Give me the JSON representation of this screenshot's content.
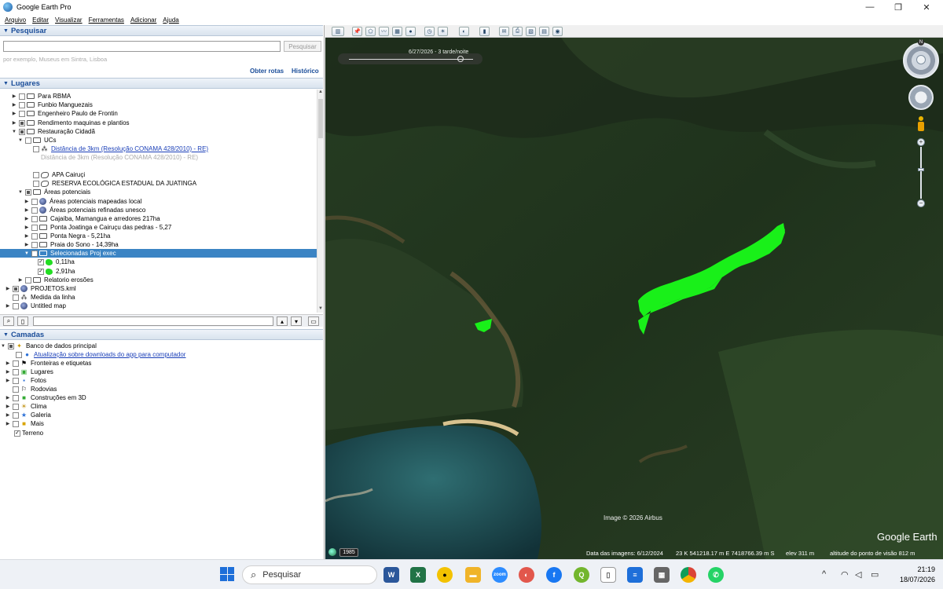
{
  "window": {
    "title": "Google Earth Pro",
    "minimize": "—",
    "maximize": "❐",
    "close": "✕"
  },
  "menu": [
    "Arquivo",
    "Editar",
    "Visualizar",
    "Ferramentas",
    "Adicionar",
    "Ajuda"
  ],
  "search": {
    "header": "Pesquisar",
    "input_value": "",
    "button": "Pesquisar",
    "hint": "por exemplo, Museus em Sintra, Lisboa",
    "get_directions": "Obter rotas",
    "history": "Histórico"
  },
  "places": {
    "header": "Lugares",
    "items": [
      {
        "label": "Para RBMA",
        "kind": "folder"
      },
      {
        "label": "Funbio Manguezais",
        "kind": "folder"
      },
      {
        "label": "Engenheiro Paulo de Frontin",
        "kind": "folder"
      },
      {
        "label": "Rendimento maquinas e plantios",
        "kind": "folder"
      },
      {
        "label": "Restauração Cidadã",
        "kind": "folder"
      },
      {
        "label": "UCs",
        "kind": "folder"
      },
      {
        "label": "Distância de 3km (Resolução CONAMA 428/2010) - RE)",
        "kind": "link"
      },
      {
        "label": "Distância de 3km (Resolução CONAMA 428/2010) - RE)",
        "kind": "grey"
      },
      {
        "label": "APA Cairuçi",
        "kind": "polygon"
      },
      {
        "label": "RESERVA ECOLÓGICA ESTADUAL DA JUATINGA",
        "kind": "polygon"
      },
      {
        "label": "Áreas potenciais",
        "kind": "folder"
      },
      {
        "label": "Áreas potenciais mapeadas local",
        "kind": "kml"
      },
      {
        "label": "Áreas potenciais refinadas unesco",
        "kind": "kml"
      },
      {
        "label": "Cajaíba, Mamangua e arredores 217ha",
        "kind": "folder"
      },
      {
        "label": "Ponta Joatinga e Cairuçu das pedras - 5,27",
        "kind": "folder"
      },
      {
        "label": "Ponta Negra - 5,21ha",
        "kind": "folder"
      },
      {
        "label": "Praia do Sono - 14,39ha",
        "kind": "folder"
      },
      {
        "label": "Selecionadas Proj exec",
        "kind": "folder"
      },
      {
        "label": "0,11ha",
        "kind": "poly"
      },
      {
        "label": "2,91ha",
        "kind": "poly"
      },
      {
        "label": "Relatorio erosões",
        "kind": "folder"
      },
      {
        "label": "PROJETOS.kml",
        "kind": "kml"
      },
      {
        "label": "Medida da linha",
        "kind": "path"
      },
      {
        "label": "Untitled map",
        "kind": "kml"
      }
    ]
  },
  "layers": {
    "header": "Camadas",
    "items": [
      {
        "label": "Banco de dados principal"
      },
      {
        "label": "Atualização sobre downloads do app para computador"
      },
      {
        "label": "Fronteiras e etiquetas"
      },
      {
        "label": "Lugares"
      },
      {
        "label": "Fotos"
      },
      {
        "label": "Rodovias"
      },
      {
        "label": "Construções em 3D"
      },
      {
        "label": "Clima"
      },
      {
        "label": "Galeria"
      },
      {
        "label": "Mais"
      },
      {
        "label": "Terreno"
      }
    ]
  },
  "map": {
    "time_label": "6/27/2026 - 3 tarde/noite",
    "image_credit": "Image © 2026 Airbus",
    "year_badge": "1985",
    "imagery_date": "Data das imagens: 6/12/2024",
    "coords": "23 K 541218.17 m E 7418766.39 m S",
    "elevation": "elev 311 m",
    "eye_alt": "altitude do ponto de visão 812 m",
    "logo": "Google Earth",
    "compass_n": "N"
  },
  "taskbar": {
    "search_placeholder": "Pesquisar",
    "time": "21:19",
    "date": "18/07/2026"
  },
  "colors": {
    "accent": "#1a4d99",
    "selection": "#3b84c4",
    "polygon": "#19f019"
  }
}
